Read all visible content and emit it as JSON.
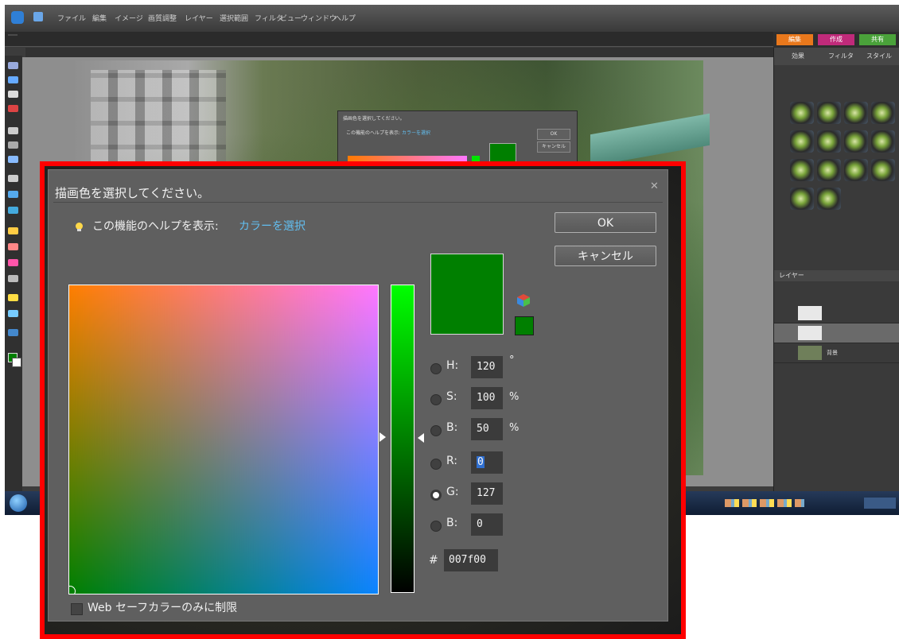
{
  "background_app": {
    "menu_items": [
      "ファイル",
      "編集",
      "イメージ",
      "画質調整",
      "レイヤー",
      "選択範囲",
      "フィルタ",
      "ビュー",
      "ウィンドウ",
      "ヘルプ"
    ],
    "modes": [
      "編集",
      "作成",
      "共有"
    ],
    "panel_tabs": [
      "効果",
      "フィルタ",
      "スタイル"
    ],
    "layers_title": "レイヤー",
    "layer_names": [
      "",
      "",
      "背景"
    ],
    "small_dialog": {
      "title": "描画色を選択してください。",
      "help": "この機能のヘルプを表示:",
      "help_link": "カラーを選択",
      "ok": "OK",
      "cancel": "キャンセル"
    }
  },
  "dialog": {
    "title": "描画色を選択してください。",
    "help_text": "この機能のヘルプを表示:",
    "help_link": "カラーを選択",
    "ok_label": "OK",
    "cancel_label": "キャンセル",
    "current_color": "#007f00",
    "fields": {
      "h": {
        "label": "H:",
        "value": "120",
        "unit": "°"
      },
      "s": {
        "label": "S:",
        "value": "100",
        "unit": "%"
      },
      "b": {
        "label": "B:",
        "value": "50",
        "unit": "%"
      },
      "r": {
        "label": "R:",
        "value": "0"
      },
      "g": {
        "label": "G:",
        "value": "127"
      },
      "b2": {
        "label": "B:",
        "value": "0"
      }
    },
    "selected_channel": "G",
    "hex_label": "#",
    "hex_value": "007f00",
    "web_safe_label": "Web セーフカラーのみに制限",
    "web_safe_checked": false
  },
  "highlight_color": "#ff0000"
}
